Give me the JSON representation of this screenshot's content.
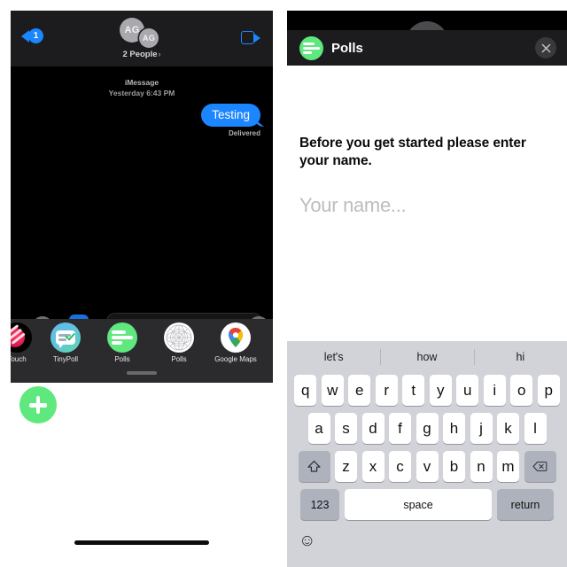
{
  "left_panel": {
    "nav": {
      "back_badge": "1",
      "back_icon": "chevron-left-icon",
      "avatar_initials_primary": "AG",
      "avatar_initials_secondary": "AG",
      "participants_label": "2 People",
      "participants_chevron": "›",
      "video_icon": "video-camera-icon"
    },
    "transcript": {
      "service_label": "iMessage",
      "timestamp": "Yesterday 6:43 PM",
      "message_text": "Testing",
      "message_status": "Delivered"
    },
    "app_drawer": {
      "apps": [
        {
          "label": "Touch",
          "icon": "digital-touch-icon"
        },
        {
          "label": "TinyPoll",
          "icon": "tinypoll-icon"
        },
        {
          "label": "Polls",
          "icon": "polls-green-icon"
        },
        {
          "label": "Polls",
          "icon": "polls-globe-icon"
        },
        {
          "label": "Google Maps",
          "icon": "google-maps-icon"
        }
      ],
      "handle": "drawer-handle"
    },
    "compose": {
      "add_button_icon": "plus-icon",
      "accent_green": "#5ee87e"
    }
  },
  "right_panel": {
    "sheet_header": {
      "app_icon": "polls-green-icon",
      "title": "Polls",
      "close_icon": "close-x-icon"
    },
    "content": {
      "prompt": "Before you get started please enter your name.",
      "name_placeholder": "Your name..."
    },
    "keyboard": {
      "suggestions": [
        "let's",
        "how",
        "hi"
      ],
      "row1": [
        "q",
        "w",
        "e",
        "r",
        "t",
        "y",
        "u",
        "i",
        "o",
        "p"
      ],
      "row2": [
        "a",
        "s",
        "d",
        "f",
        "g",
        "h",
        "j",
        "k",
        "l"
      ],
      "row3": [
        "z",
        "x",
        "c",
        "v",
        "b",
        "n",
        "m"
      ],
      "shift_icon": "shift-arrow-icon",
      "delete_icon": "backspace-icon",
      "numbers_label": "123",
      "space_label": "space",
      "return_label": "return",
      "emoji_icon": "smiley-face-icon"
    }
  },
  "colors": {
    "imessage_blue": "#1b86ff",
    "polls_green": "#5ee87e",
    "keyboard_bg": "#d1d3d9"
  }
}
